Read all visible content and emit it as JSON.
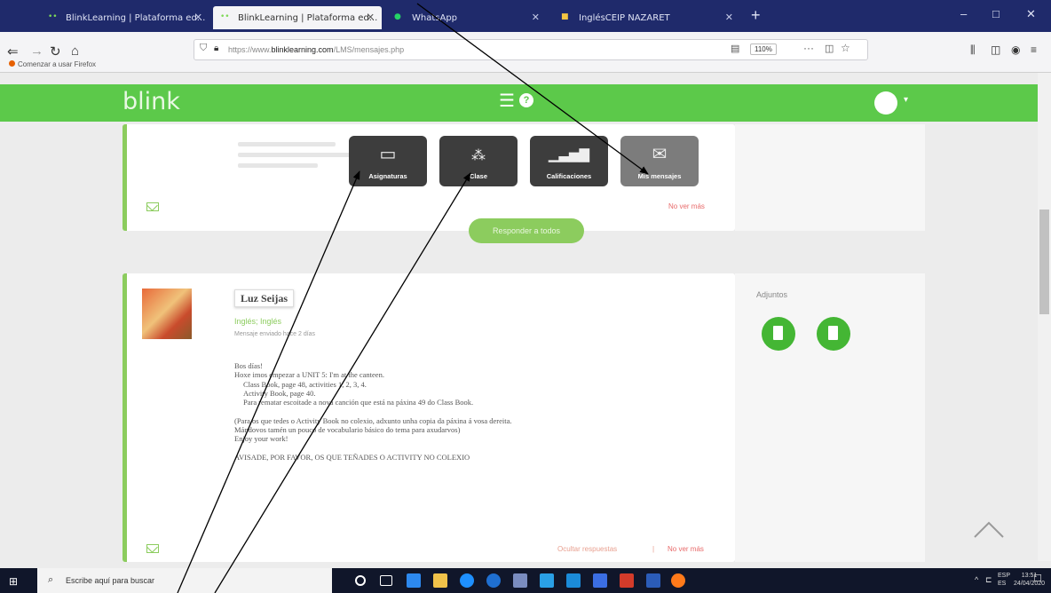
{
  "browser": {
    "tabs": [
      {
        "label": "BlinkLearning | Plataforma ed..."
      },
      {
        "label": "BlinkLearning | Plataforma ed..."
      },
      {
        "label": "WhatsApp"
      },
      {
        "label": "InglésCEIP NAZARET"
      }
    ],
    "url_prefix": "https://www.",
    "url_domain": "blinklearning.com",
    "url_path": "/LMS/mensajes.php",
    "zoom": "110%",
    "bookmark": "Comenzar a usar Firefox",
    "icons": [
      "back-icon",
      "forward-icon",
      "reload-icon",
      "home-icon",
      "shield-icon",
      "lock-icon",
      "reader-icon",
      "more-icon",
      "pocket-icon",
      "star-icon",
      "library-icon",
      "sidebar-icon",
      "account-icon",
      "menu-icon"
    ]
  },
  "site": {
    "logo": "blink",
    "brand_color": "#5cc94a"
  },
  "quicknav": [
    {
      "label": "Asignaturas",
      "icon": "folder-icon"
    },
    {
      "label": "Clase",
      "icon": "class-icon"
    },
    {
      "label": "Calificaciones",
      "icon": "grades-icon"
    },
    {
      "label": "Mis mensajes",
      "icon": "mail-icon"
    }
  ],
  "card1": {
    "no_ver_mas": "No ver más",
    "reply_all": "Responder a todos"
  },
  "message": {
    "sender": "Luz Seijas",
    "subject": "Inglés; Inglés",
    "sent": "Mensaje enviado hace 2 días",
    "body": [
      "Bos días!",
      "Hoxe imos empezar a UNIT 5: I'm at the canteen.",
      "   Class Book, page 48, activities 1, 2, 3, 4.",
      "   Activity Book, page 40.",
      "   Para rematar escoitade a nova canción que está na páxina 49 do Class Book.",
      "",
      "(Para os que tedes o Activity Book no colexio, adxunto unha copia da páxina á vosa dereita.",
      "Mándovos tamén un pouco de vocabulario básico do tema para axudarvos)",
      "Enjoy your work!",
      "",
      "AVISADE, POR FAVOR, OS QUE TEÑADES O ACTIVITY NO COLEXIO"
    ],
    "hide_replies": "Ocultar respuestas",
    "separator": "|",
    "no_ver_mas": "No ver más",
    "attachments_label": "Adjuntos"
  },
  "taskbar": {
    "search_placeholder": "Escribe aquí para buscar",
    "lang_top": "ESP",
    "lang_bottom": "ES",
    "time": "13:51",
    "date": "24/04/2020"
  }
}
